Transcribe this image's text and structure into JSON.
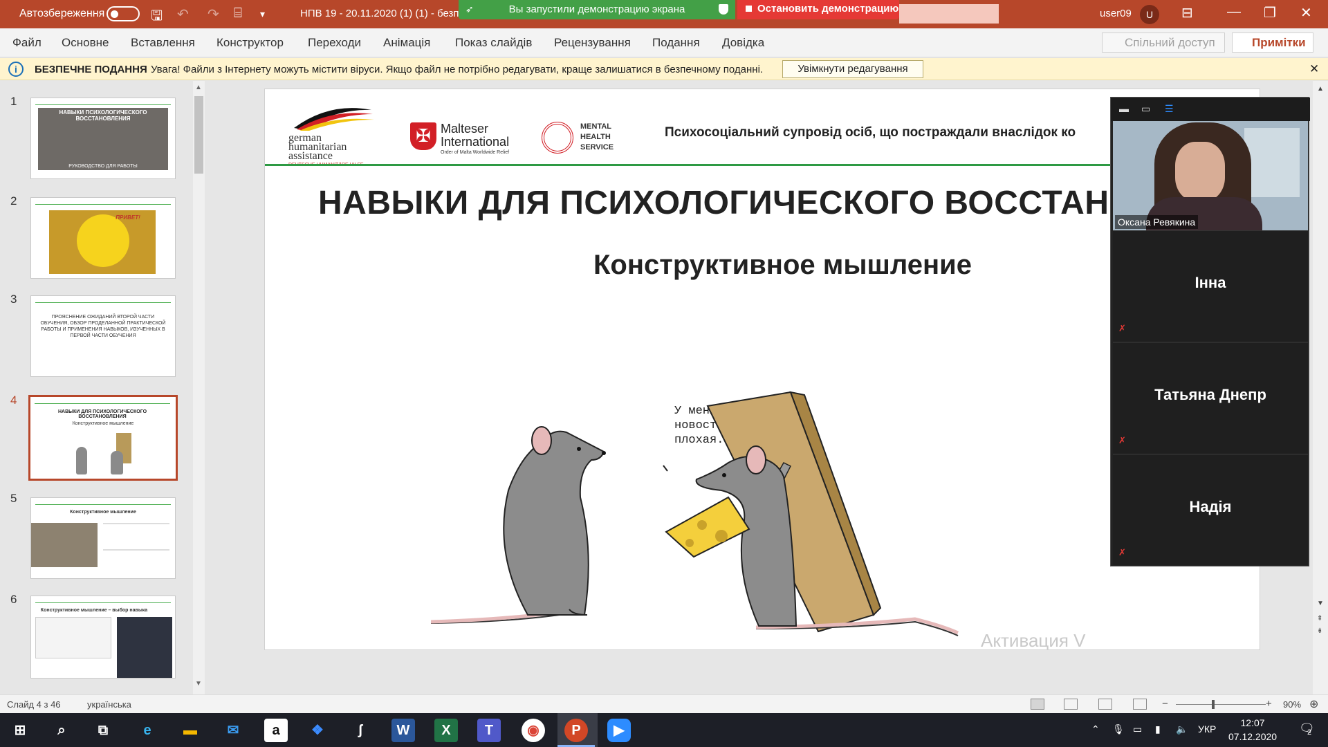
{
  "titlebar": {
    "autosave_label": "Автозбереження",
    "doc_title": "НПВ 19 - 20.11.2020 (1) (1)  -  безп",
    "share_banner": "Вы запустили демонстрацию экрана",
    "stop_share": "Остановить демонстрацию",
    "user_name": "user09",
    "avatar_letter": "U",
    "accent": "#b7472a"
  },
  "ribbon": {
    "tabs": [
      "Файл",
      "Основне",
      "Вставлення",
      "Конструктор",
      "Переходи",
      "Анімація",
      "Показ слайдів",
      "Рецензування",
      "Подання",
      "Довідка"
    ],
    "share_label": "Спільний доступ",
    "comments_label": "Примітки"
  },
  "protected_view": {
    "title": "БЕЗПЕЧНЕ ПОДАННЯ",
    "message": "Увага! Файли з Інтернету можуть містити віруси. Якщо файл не потрібно редагувати, краще залишатися в безпечному поданні.",
    "enable_button": "Увімкнути редагування"
  },
  "thumbnails": [
    {
      "num": "1",
      "title": "НАВЫКИ ПСИХОЛОГИЧЕСКОГО ВОССТАНОВЛЕНИЯ",
      "sub": "РУКОВОДСТВО ДЛЯ РАБОТЫ"
    },
    {
      "num": "2",
      "title": "ПРИВЕТ!"
    },
    {
      "num": "3",
      "title": "ПРОЯСНЕНИЕ ОЖИДАНИЙ ВТОРОЙ ЧАСТИ ОБУЧЕНИЯ, ОБЗОР ПРОДЕЛАННОЙ ПРАКТИЧЕСКОЙ РАБОТЫ И ПРИМЕНЕНИЯ НАВЫКОВ, ИЗУЧЕННЫХ В ПЕРВОЙ ЧАСТИ ОБУЧЕНИЯ"
    },
    {
      "num": "4",
      "title": "НАВЫКИ ДЛЯ ПСИХОЛОГИЧЕСКОГО ВОССТАНОВЛЕНИЯ",
      "sub": "Конструктивное мышление"
    },
    {
      "num": "5",
      "title": "Конструктивное мышление"
    },
    {
      "num": "6",
      "title": "Конструктивное мышление – выбор навыка"
    }
  ],
  "slide": {
    "logo_german_1": "german",
    "logo_german_2": "humanitarian",
    "logo_german_3": "assistance",
    "logo_german_4": "DEUTSCHE HUMANITÄRE HILFE",
    "logo_malteser_1": "Malteser",
    "logo_malteser_2": "International",
    "logo_malteser_3": "Order of Malta Worldwide Relief",
    "logo_mhs_1": "MENTAL",
    "logo_mhs_2": "HEALTH",
    "logo_mhs_3": "SERVICE",
    "header_text": "Психосоціальний супровід осіб, що постраждали внаслідок ко",
    "title": "НАВЫКИ ДЛЯ ПСИХОЛОГИЧЕСКОГО ВОССТАНОВЛ",
    "subtitle": "Конструктивное мышление",
    "speech": "У меня есть две\nновости: хорошая и\nплохая...",
    "watermark": "Активация V"
  },
  "zoom": {
    "speaker_name": "Оксана Ревякина",
    "participants": [
      "Інна",
      "Татьяна Днепр",
      "Надія"
    ]
  },
  "statusbar": {
    "slide_info": "Слайд 4 з 46",
    "language": "українська",
    "zoom_level": "90%"
  },
  "taskbar": {
    "tray_lang": "УКР",
    "time": "12:07",
    "date": "07.12.2020",
    "notifications": "2"
  }
}
